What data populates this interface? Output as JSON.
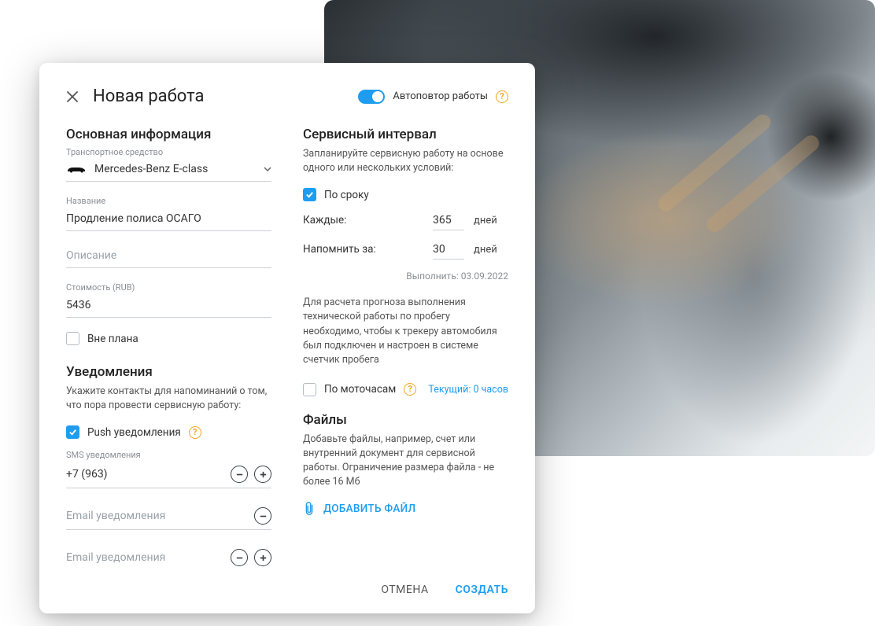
{
  "header": {
    "title": "Новая работа",
    "toggle_label": "Автоповтор работы"
  },
  "left": {
    "section1_title": "Основная информация",
    "vehicle_label": "Транспортное средство",
    "vehicle_value": "Mercedes-Benz E-class",
    "name_label": "Название",
    "name_value": "Продление полиса ОСАГО",
    "desc_placeholder": "Описание",
    "cost_label": "Стоимость (RUB)",
    "cost_value": "5436",
    "outplan_label": "Вне плана",
    "section2_title": "Уведомления",
    "section2_desc": "Укажите контакты для напоминаний о том, что пора провести сервисную работу:",
    "push_label": "Push уведомления",
    "sms_label": "SMS уведомления",
    "sms_value": "+7 (963)",
    "email_placeholder": "Email уведомления"
  },
  "right": {
    "section1_title": "Сервисный интервал",
    "section1_desc": "Запланируйте сервисную работу на основе одного или нескольких условий:",
    "by_time_label": "По сроку",
    "every_label": "Каждые:",
    "every_value": "365",
    "every_unit": "дней",
    "remind_label": "Напомнить за:",
    "remind_value": "30",
    "remind_unit": "дней",
    "exec_label": "Выполнить: 03.09.2022",
    "mileage_note": "Для расчета прогноза выполнения технической работы по пробегу необходимо, чтобы к трекеру автомобиля был подключен и настроен в системе счетчик пробега",
    "by_hours_label": "По моточасам",
    "current_hours": "Текущий: 0 часов",
    "section2_title": "Файлы",
    "section2_desc": "Добавьте файлы, например, счет или внутренний документ для сервисной работы. Ограничение размера файла - не более 16 Мб",
    "add_file": "ДОБАВИТЬ ФАЙЛ"
  },
  "footer": {
    "cancel": "ОТМЕНА",
    "create": "СОЗДАТЬ"
  }
}
